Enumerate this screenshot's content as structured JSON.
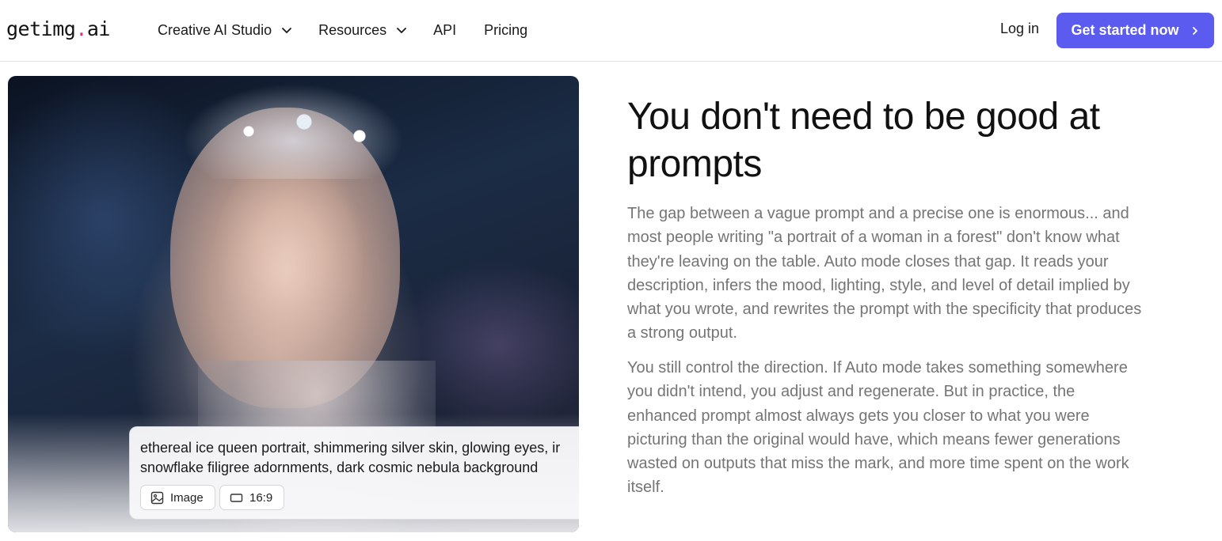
{
  "header": {
    "logo_main": "getimg",
    "logo_dot": ".",
    "logo_suffix": "ai",
    "nav": [
      {
        "label": "Creative AI Studio",
        "has_dropdown": true
      },
      {
        "label": "Resources",
        "has_dropdown": true
      },
      {
        "label": "API",
        "has_dropdown": false
      },
      {
        "label": "Pricing",
        "has_dropdown": false
      }
    ],
    "login_label": "Log in",
    "cta_label": "Get started now",
    "cta_color": "#5b5bf0",
    "logo_dot_color": "#e5336c"
  },
  "hero": {
    "prompt_line1": "ethereal ice queen portrait, shimmering silver skin, glowing eyes, ir",
    "prompt_line2": "snowflake filigree adornments, dark cosmic nebula background",
    "chip_type_icon": "image-icon",
    "chip_type_label": "Image",
    "chip_ratio_icon": "aspect-ratio-icon",
    "chip_ratio_label": "16:9"
  },
  "content": {
    "headline": "You don't need to be good at prompts",
    "paragraph1": "The gap between a vague prompt and a precise one is enormous... and most people writing \"a portrait of a woman in a forest\" don't know what they're leaving on the table. Auto mode closes that gap. It reads your description, infers the mood, lighting, style, and level of detail implied by what you wrote, and rewrites the prompt with the specificity that produces a strong output.",
    "paragraph2": "You still control the direction. If Auto mode takes something somewhere you didn't intend, you adjust and regenerate. But in practice, the enhanced prompt almost always gets you closer to what you were picturing than the original would have, which means fewer generations wasted on outputs that miss the mark, and more time spent on the work itself."
  }
}
